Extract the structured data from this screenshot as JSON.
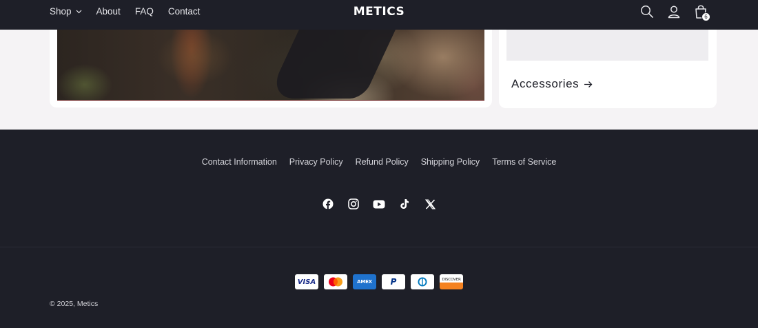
{
  "header": {
    "logo": "METICS",
    "nav": [
      {
        "label": "Shop",
        "has_dropdown": true
      },
      {
        "label": "About"
      },
      {
        "label": "FAQ"
      },
      {
        "label": "Contact"
      }
    ],
    "icons": [
      "search-icon",
      "account-icon",
      "cart-icon"
    ],
    "cart_count": "6",
    "colors": {
      "background": "#1e1f28",
      "text": "#e6e6ea"
    }
  },
  "main": {
    "right_card": {
      "link_label": "Accessories"
    }
  },
  "footer": {
    "policies": [
      "Contact Information",
      "Privacy Policy",
      "Refund Policy",
      "Shipping Policy",
      "Terms of Service"
    ],
    "social": [
      "facebook-icon",
      "instagram-icon",
      "youtube-icon",
      "tiktok-icon",
      "x-icon"
    ],
    "payments": [
      {
        "name": "visa",
        "label": "VISA"
      },
      {
        "name": "mastercard"
      },
      {
        "name": "amex",
        "label": "AMEX"
      },
      {
        "name": "paypal",
        "label": "P"
      },
      {
        "name": "diners"
      },
      {
        "name": "discover",
        "label": "DISCOVER"
      }
    ],
    "copyright_symbol": "©",
    "copyright_year_brand": "2025, Metics",
    "colors": {
      "background": "#1e1f28"
    }
  }
}
